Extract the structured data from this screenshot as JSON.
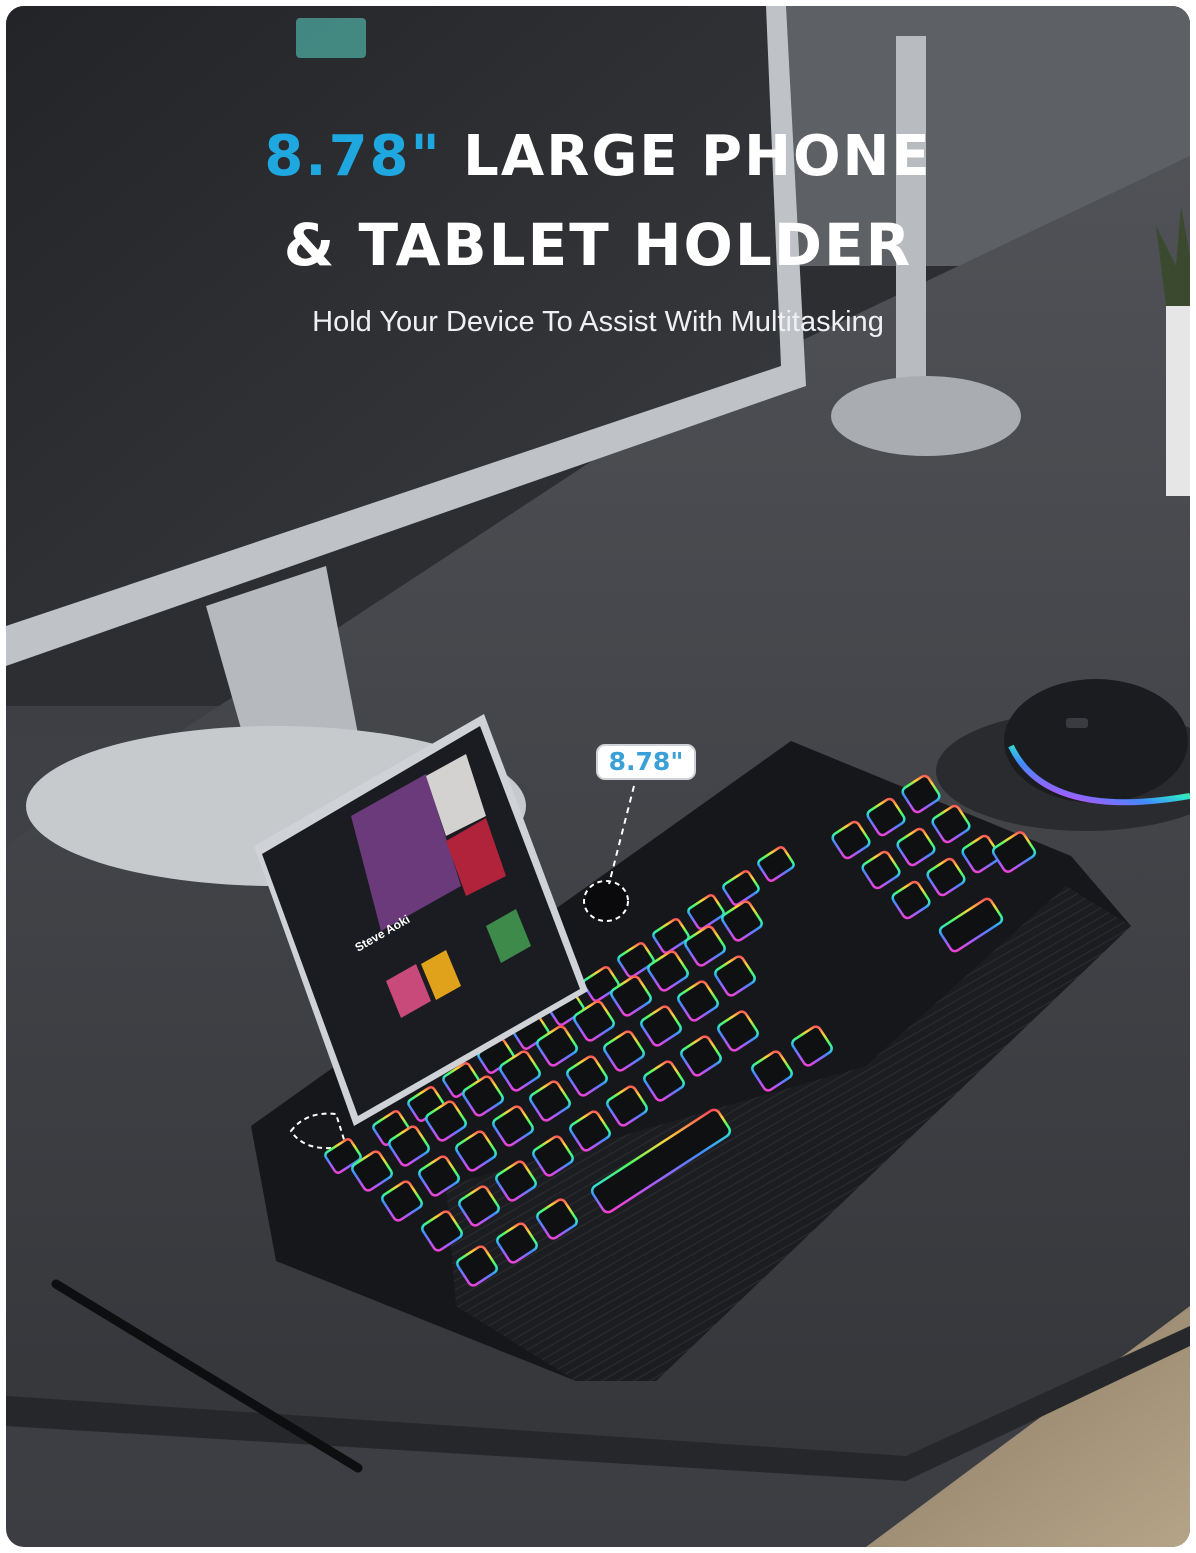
{
  "headline": {
    "accent": "8.78\"",
    "line1_rest": " LARGE PHONE",
    "line2": "& TABLET HOLDER"
  },
  "subtitle": "Hold Your Device To Assist With Multitasking",
  "callout": {
    "label": "8.78\""
  },
  "tablet_screen": {
    "artist": "Steve Aoki"
  },
  "colors": {
    "accent": "#1fa7e0",
    "background": "#3a3c41",
    "keyboard": "#16171a"
  }
}
